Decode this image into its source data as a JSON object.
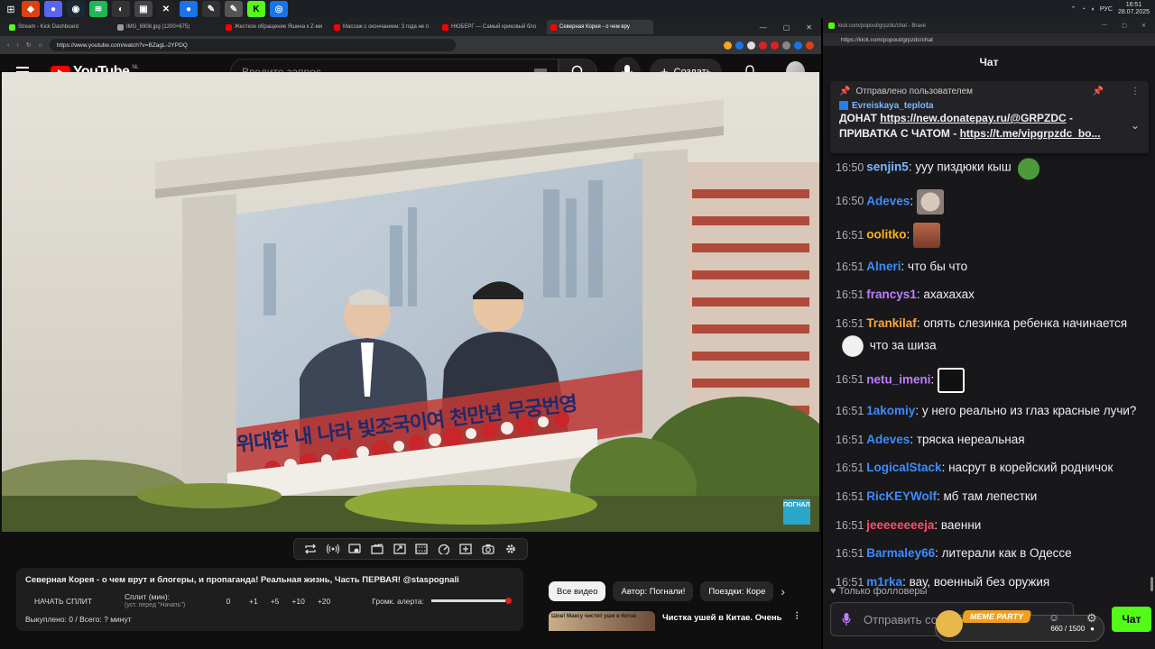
{
  "taskbar": {
    "lang": "РУС",
    "time": "16:51",
    "date": "28.07.2025"
  },
  "browser": {
    "tabs": [
      {
        "label": "Stream - Kick Dashboard",
        "color": "#53fc18"
      },
      {
        "label": "IMG_6908.jpg (1200×675)",
        "color": "#999999"
      },
      {
        "label": "Жесткое обращение Яшина к Z-ми",
        "color": "#ff0000"
      },
      {
        "label": "Массаж с окончанием: 3 года не п",
        "color": "#ff0000"
      },
      {
        "label": "НЮБЕРГ — Самый криковый бло",
        "color": "#ff0000"
      },
      {
        "label": "Северная Корея - о чем вру",
        "color": "#ff0000"
      }
    ],
    "url": "https://www.youtube.com/watch?v=BZagL-2YPDQ"
  },
  "youtube": {
    "logo_text": "YouTube",
    "region": "NL",
    "search_placeholder": "Введите запрос",
    "create_label": "Создать"
  },
  "video": {
    "banner_text": "위대한 내 나라 빛조국이여 천만년 무궁번영",
    "watermark": "ПОГНАЛИ"
  },
  "panel": {
    "title": "Северная Корея - о чем врут и блогеры, и пропаганда! Реальная жизнь, Часть ПЕРВАЯ! @staspognali",
    "start_split": "НАЧАТЬ СПЛИТ",
    "split_label": "Сплит (мин):",
    "split_hint": "(уст. перед \"Начать\")",
    "split_value": "0",
    "increments": [
      "+1",
      "+5",
      "+10",
      "+20"
    ],
    "alert_volume_label": "Громк. алерта:",
    "alert_volume": 1.0,
    "bought": "Выкуплено: 0 / Всего: ? минут"
  },
  "chips": [
    "Все видео",
    "Автор: Погнали!",
    "Поездки: Коре"
  ],
  "next_video": {
    "thumb_text": "Шов! Максу чистят уши в Китае",
    "title": "Чистка ушей в Китае. Очень"
  },
  "chat": {
    "url": "kick.com/popout/grpzdc/chat - Brave",
    "address": "https://kick.com/popout/grpzdc/chat",
    "title": "Чат",
    "pinned_header": "Отправлено пользователем",
    "pinned_user": "Evreiskaya_teplota",
    "pinned_line1_prefix": "ДОНАТ ",
    "pinned_line1_link": "https://new.donatepay.ru/@GRPZDC",
    "pinned_line1_suffix": " -",
    "pinned_line2_prefix": "ПРИВАТКА С ЧАТОМ - ",
    "pinned_line2_link": "https://t.me/vipgrpzdc_bo...",
    "messages": [
      {
        "time": "16:50",
        "user": "senjin5",
        "color": "#7cb7ff",
        "text": ": ууу пиздюки кыш",
        "emote": "pepe"
      },
      {
        "time": "16:50",
        "user": "Adeves",
        "color": "#3d8bff",
        "text": ":",
        "emote": "mouse"
      },
      {
        "time": "16:51",
        "user": "oolitko",
        "color": "#ffb020",
        "text": ":",
        "emote": "face"
      },
      {
        "time": "16:51",
        "user": "Alneri",
        "color": "#3d8bff",
        "text": ": что бы что",
        "emote": ""
      },
      {
        "time": "16:51",
        "user": "francys1",
        "color": "#c07cff",
        "text": ": ахахахах",
        "emote": ""
      },
      {
        "time": "16:51",
        "user": "Trankilaf",
        "color": "#ffa640",
        "text": ": опять слезинка ребенка начинается",
        "emote": "troll",
        "after": " что за шиза"
      },
      {
        "time": "16:51",
        "user": "netu_imeni",
        "color": "#c07cff",
        "text": ":",
        "emote": "smile"
      },
      {
        "time": "16:51",
        "user": "1akomiy",
        "color": "#3d8bff",
        "text": ": у него реально из глаз красные лучи?",
        "emote": ""
      },
      {
        "time": "16:51",
        "user": "Adeves",
        "color": "#3d8bff",
        "text": ": тряска нереальная",
        "emote": ""
      },
      {
        "time": "16:51",
        "user": "LogicalStack",
        "color": "#3d8bff",
        "text": ": насрут в корейский родничок",
        "emote": ""
      },
      {
        "time": "16:51",
        "user": "RicKEYWolf",
        "color": "#3d8bff",
        "text": ": мб там лепестки",
        "emote": ""
      },
      {
        "time": "16:51",
        "user": "jeeeeeeeeja",
        "color": "#ff4d6a",
        "text": ": ваенни",
        "emote": ""
      },
      {
        "time": "16:51",
        "user": "Barmaley66",
        "color": "#3d8bff",
        "text": ": литерали как в Одессе",
        "emote": ""
      },
      {
        "time": "16:51",
        "user": "m1rka",
        "color": "#3d8bff",
        "text": ": вау, военный без оружия",
        "emote": ""
      }
    ],
    "followers_only": "Только фолловеры",
    "input_placeholder": "Отправить сообщение",
    "send_label": "Чат",
    "meme_party": "MEME PARTY",
    "meme_progress": "660 / 1500"
  },
  "colors": {
    "kick_green": "#53fc18",
    "yt_red": "#ff0000"
  }
}
